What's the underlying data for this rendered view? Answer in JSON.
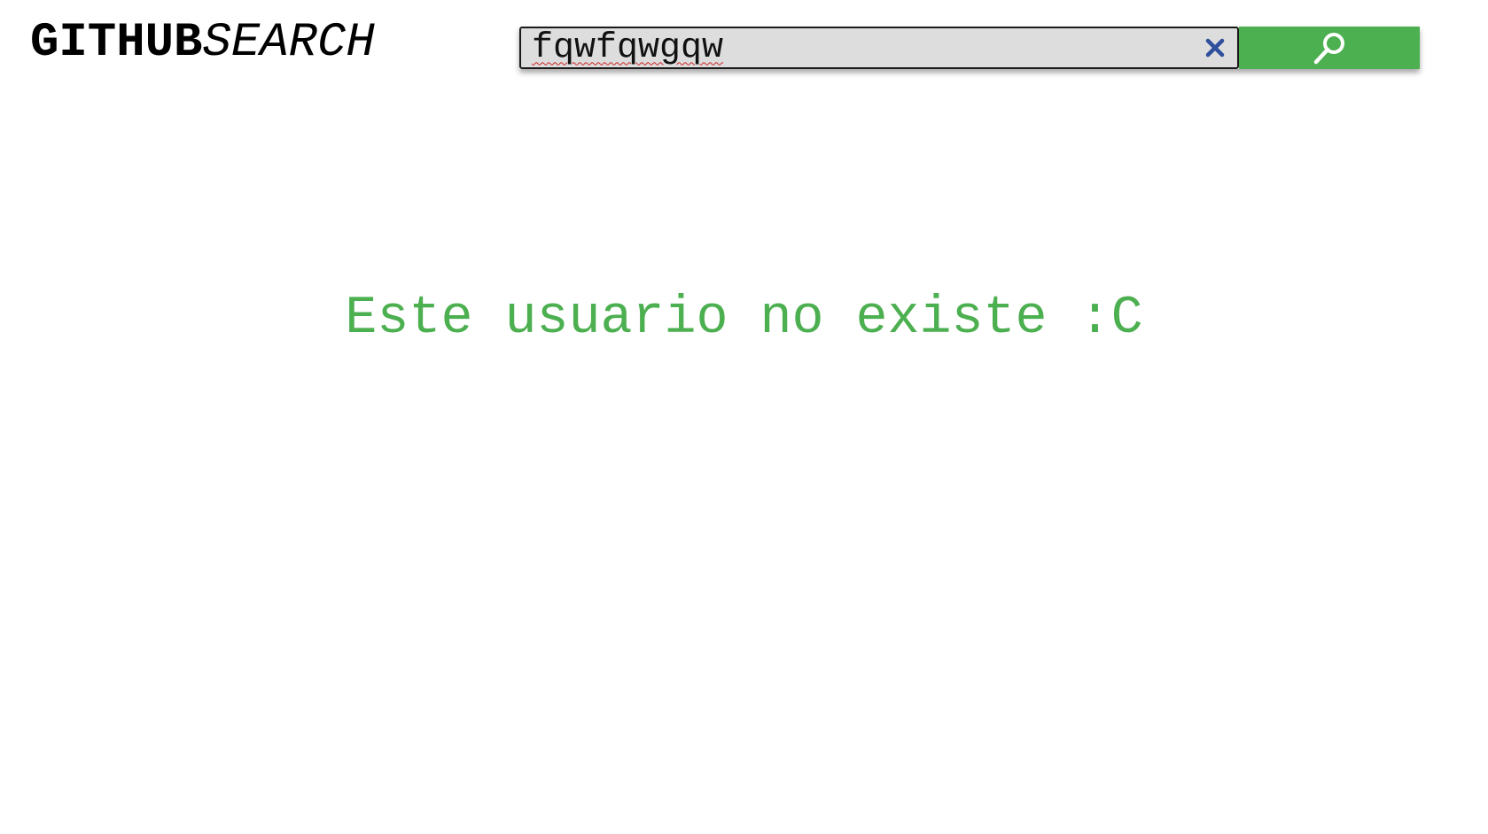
{
  "header": {
    "logo_bold": "GITHUB",
    "logo_italic": "SEARCH"
  },
  "search": {
    "value": "fqwfqwgqw",
    "clear_icon": "close-icon",
    "submit_icon": "search-icon"
  },
  "main": {
    "message": "Este usuario no existe :C"
  },
  "colors": {
    "accent": "#4caf50",
    "input_background": "#dddddd",
    "clear_icon": "#2f4f9c"
  }
}
